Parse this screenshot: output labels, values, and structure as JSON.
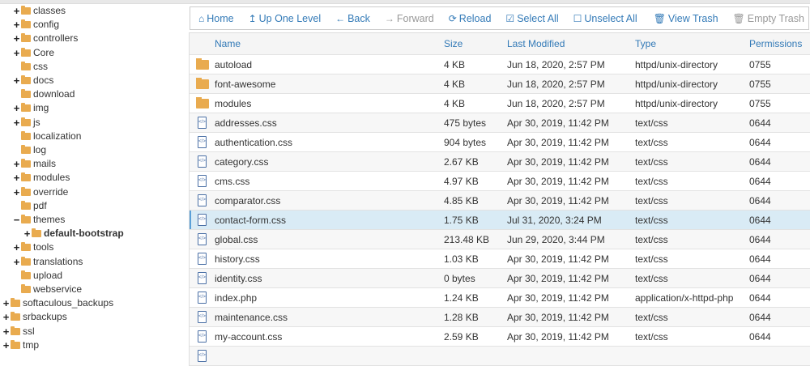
{
  "tree": [
    {
      "label": "classes",
      "expand": "+",
      "level": 1
    },
    {
      "label": "config",
      "expand": "+",
      "level": 1
    },
    {
      "label": "controllers",
      "expand": "+",
      "level": 1
    },
    {
      "label": "Core",
      "expand": "+",
      "level": 1
    },
    {
      "label": "css",
      "expand": "",
      "level": 1
    },
    {
      "label": "docs",
      "expand": "+",
      "level": 1
    },
    {
      "label": "download",
      "expand": "",
      "level": 1
    },
    {
      "label": "img",
      "expand": "+",
      "level": 1
    },
    {
      "label": "js",
      "expand": "+",
      "level": 1
    },
    {
      "label": "localization",
      "expand": "",
      "level": 1
    },
    {
      "label": "log",
      "expand": "",
      "level": 1
    },
    {
      "label": "mails",
      "expand": "+",
      "level": 1
    },
    {
      "label": "modules",
      "expand": "+",
      "level": 1
    },
    {
      "label": "override",
      "expand": "+",
      "level": 1
    },
    {
      "label": "pdf",
      "expand": "",
      "level": 1
    },
    {
      "label": "themes",
      "expand": "−",
      "level": 1
    },
    {
      "label": "default-bootstrap",
      "expand": "+",
      "level": 2,
      "bold": true
    },
    {
      "label": "tools",
      "expand": "+",
      "level": 1
    },
    {
      "label": "translations",
      "expand": "+",
      "level": 1
    },
    {
      "label": "upload",
      "expand": "",
      "level": 1
    },
    {
      "label": "webservice",
      "expand": "",
      "level": 1
    },
    {
      "label": "softaculous_backups",
      "expand": "+",
      "level": 0
    },
    {
      "label": "srbackups",
      "expand": "+",
      "level": 0
    },
    {
      "label": "ssl",
      "expand": "+",
      "level": 0
    },
    {
      "label": "tmp",
      "expand": "+",
      "level": 0
    }
  ],
  "toolbar": {
    "home": "Home",
    "up": "Up One Level",
    "back": "Back",
    "forward": "Forward",
    "reload": "Reload",
    "select_all": "Select All",
    "unselect_all": "Unselect All",
    "view_trash": "View Trash",
    "empty_trash": "Empty Trash"
  },
  "columns": {
    "name": "Name",
    "size": "Size",
    "modified": "Last Modified",
    "type": "Type",
    "perms": "Permissions"
  },
  "files": [
    {
      "icon": "folder",
      "name": "autoload",
      "size": "4 KB",
      "modified": "Jun 18, 2020, 2:57 PM",
      "type": "httpd/unix-directory",
      "perms": "0755"
    },
    {
      "icon": "folder",
      "name": "font-awesome",
      "size": "4 KB",
      "modified": "Jun 18, 2020, 2:57 PM",
      "type": "httpd/unix-directory",
      "perms": "0755"
    },
    {
      "icon": "folder",
      "name": "modules",
      "size": "4 KB",
      "modified": "Jun 18, 2020, 2:57 PM",
      "type": "httpd/unix-directory",
      "perms": "0755"
    },
    {
      "icon": "file",
      "name": "addresses.css",
      "size": "475 bytes",
      "modified": "Apr 30, 2019, 11:42 PM",
      "type": "text/css",
      "perms": "0644"
    },
    {
      "icon": "file",
      "name": "authentication.css",
      "size": "904 bytes",
      "modified": "Apr 30, 2019, 11:42 PM",
      "type": "text/css",
      "perms": "0644"
    },
    {
      "icon": "file",
      "name": "category.css",
      "size": "2.67 KB",
      "modified": "Apr 30, 2019, 11:42 PM",
      "type": "text/css",
      "perms": "0644"
    },
    {
      "icon": "file",
      "name": "cms.css",
      "size": "4.97 KB",
      "modified": "Apr 30, 2019, 11:42 PM",
      "type": "text/css",
      "perms": "0644"
    },
    {
      "icon": "file",
      "name": "comparator.css",
      "size": "4.85 KB",
      "modified": "Apr 30, 2019, 11:42 PM",
      "type": "text/css",
      "perms": "0644"
    },
    {
      "icon": "file",
      "name": "contact-form.css",
      "size": "1.75 KB",
      "modified": "Jul 31, 2020, 3:24 PM",
      "type": "text/css",
      "perms": "0644",
      "selected": true
    },
    {
      "icon": "file",
      "name": "global.css",
      "size": "213.48 KB",
      "modified": "Jun 29, 2020, 3:44 PM",
      "type": "text/css",
      "perms": "0644"
    },
    {
      "icon": "file",
      "name": "history.css",
      "size": "1.03 KB",
      "modified": "Apr 30, 2019, 11:42 PM",
      "type": "text/css",
      "perms": "0644"
    },
    {
      "icon": "file",
      "name": "identity.css",
      "size": "0 bytes",
      "modified": "Apr 30, 2019, 11:42 PM",
      "type": "text/css",
      "perms": "0644"
    },
    {
      "icon": "file",
      "name": "index.php",
      "size": "1.24 KB",
      "modified": "Apr 30, 2019, 11:42 PM",
      "type": "application/x-httpd-php",
      "perms": "0644"
    },
    {
      "icon": "file",
      "name": "maintenance.css",
      "size": "1.28 KB",
      "modified": "Apr 30, 2019, 11:42 PM",
      "type": "text/css",
      "perms": "0644"
    },
    {
      "icon": "file",
      "name": "my-account.css",
      "size": "2.59 KB",
      "modified": "Apr 30, 2019, 11:42 PM",
      "type": "text/css",
      "perms": "0644"
    },
    {
      "icon": "file",
      "name": "",
      "size": "",
      "modified": "",
      "type": "",
      "perms": ""
    }
  ]
}
